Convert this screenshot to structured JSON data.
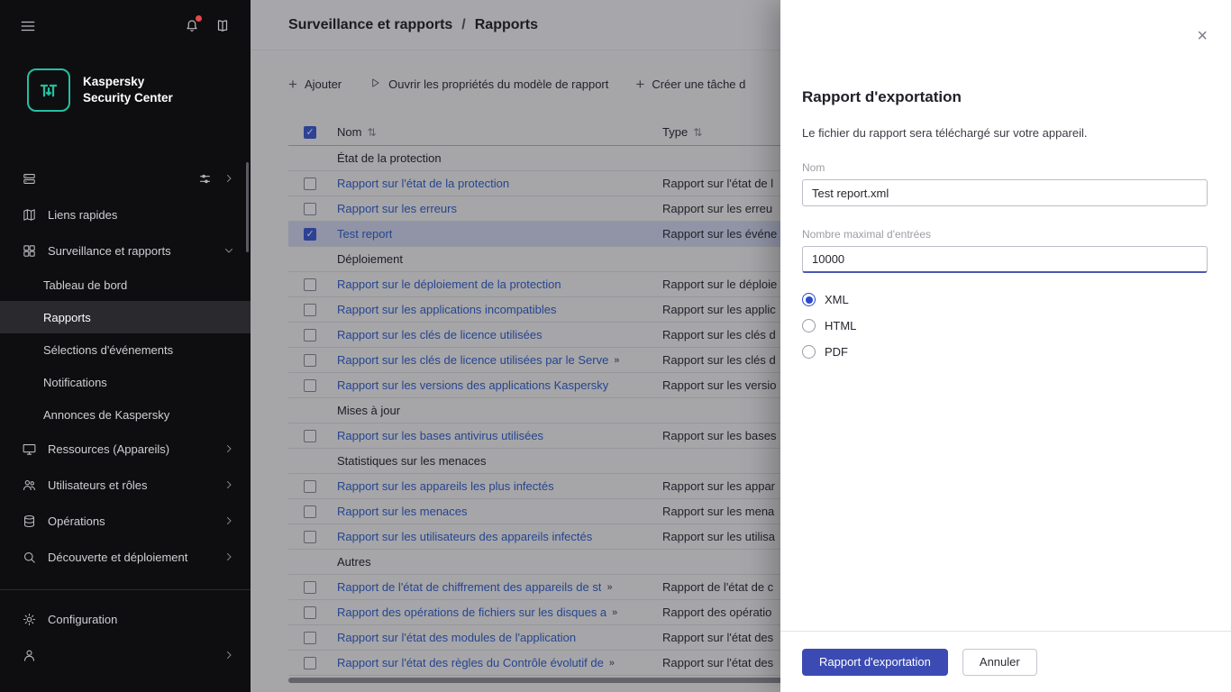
{
  "colors": {
    "accent": "#3b4bb3",
    "link": "#3361cc",
    "checkbox": "#3e5bd6",
    "logo": "#23c0a0",
    "red": "#e5484d",
    "sidebar-bg": "#0e0e10",
    "sidebar-sel": "#29292e"
  },
  "sidebar": {
    "logo": {
      "line1": "Kaspersky",
      "line2": "Security Center"
    },
    "items": [
      {
        "id": "server",
        "label": "",
        "redacted": true
      },
      {
        "id": "liens-rapides",
        "label": "Liens rapides"
      },
      {
        "id": "surveillance",
        "label": "Surveillance et rapports",
        "expanded": true
      },
      {
        "id": "tableau-de-bord",
        "label": "Tableau de bord"
      },
      {
        "id": "rapports",
        "label": "Rapports",
        "selected": true
      },
      {
        "id": "selections-evenements",
        "label": "Sélections d'événements"
      },
      {
        "id": "notifications",
        "label": "Notifications"
      },
      {
        "id": "annonces",
        "label": "Annonces de Kaspersky"
      },
      {
        "id": "ressources",
        "label": "Ressources (Appareils)"
      },
      {
        "id": "utilisateurs",
        "label": "Utilisateurs et rôles"
      },
      {
        "id": "operations",
        "label": "Opérations"
      },
      {
        "id": "decouverte",
        "label": "Découverte et déploiement"
      },
      {
        "id": "configuration",
        "label": "Configuration"
      },
      {
        "id": "user",
        "label": "",
        "redacted": true
      }
    ]
  },
  "header": {
    "breadcrumb_parent": "Surveillance et rapports",
    "breadcrumb_sep": "/",
    "breadcrumb_current": "Rapports"
  },
  "toolbar": {
    "plus_glyph": "+",
    "add": "Ajouter",
    "open_properties": "Ouvrir les propriétés du modèle de rapport",
    "create_task": "Créer une tâche d"
  },
  "table": {
    "header_checkbox_checked": true,
    "truncation_glyph": "»",
    "columns": [
      {
        "label": "Nom",
        "sort_icon": "⇅"
      },
      {
        "label": "Type",
        "sort_icon": "⇅"
      }
    ],
    "rows": [
      {
        "section": "État de la protection"
      },
      {
        "name": "Rapport sur l'état de la protection",
        "type": "Rapport sur l'état de l"
      },
      {
        "name": "Rapport sur les erreurs",
        "type": "Rapport sur les erreu"
      },
      {
        "name": "Test report",
        "type": "Rapport sur les événe",
        "checked": true,
        "selected": true
      },
      {
        "section": "Déploiement"
      },
      {
        "name": "Rapport sur le déploiement de la protection",
        "type": "Rapport sur le déploie"
      },
      {
        "name": "Rapport sur les applications incompatibles",
        "type": "Rapport sur les applic"
      },
      {
        "name": "Rapport sur les clés de licence utilisées",
        "type": "Rapport sur les clés d"
      },
      {
        "name": "Rapport sur les clés de licence utilisées par le Serve",
        "type": "Rapport sur les clés d",
        "truncated": true
      },
      {
        "name": "Rapport sur les versions des applications Kaspersky",
        "type": "Rapport sur les versio"
      },
      {
        "section": "Mises à jour"
      },
      {
        "name": "Rapport sur les bases antivirus utilisées",
        "type": "Rapport sur les bases"
      },
      {
        "section": "Statistiques sur les menaces"
      },
      {
        "name": "Rapport sur les appareils les plus infectés",
        "type": "Rapport sur les appar"
      },
      {
        "name": "Rapport sur les menaces",
        "type": "Rapport sur les mena"
      },
      {
        "name": "Rapport sur les utilisateurs des appareils infectés",
        "type": "Rapport sur les utilisa"
      },
      {
        "section": "Autres"
      },
      {
        "name": "Rapport de l'état de chiffrement des appareils de st",
        "type": "Rapport de l'état de c",
        "truncated": true
      },
      {
        "name": "Rapport des opérations de fichiers sur les disques a",
        "type": "Rapport des opératio",
        "truncated": true
      },
      {
        "name": "Rapport sur l'état des modules de l'application",
        "type": "Rapport sur l'état des"
      },
      {
        "name": "Rapport sur l'état des règles du Contrôle évolutif de",
        "type": "Rapport sur l'état des",
        "truncated": true
      }
    ]
  },
  "panel": {
    "close_glyph": "×",
    "title": "Rapport d'exportation",
    "description": "Le fichier du rapport sera téléchargé sur votre appareil.",
    "fields": {
      "name_label": "Nom",
      "name_value": "Test report.xml",
      "max_entries_label": "Nombre maximal d'entrées",
      "max_entries_value": "10000"
    },
    "format_options": [
      {
        "label": "XML",
        "selected": true
      },
      {
        "label": "HTML",
        "selected": false
      },
      {
        "label": "PDF",
        "selected": false
      }
    ],
    "buttons": {
      "export": "Rapport d'exportation",
      "cancel": "Annuler"
    }
  }
}
